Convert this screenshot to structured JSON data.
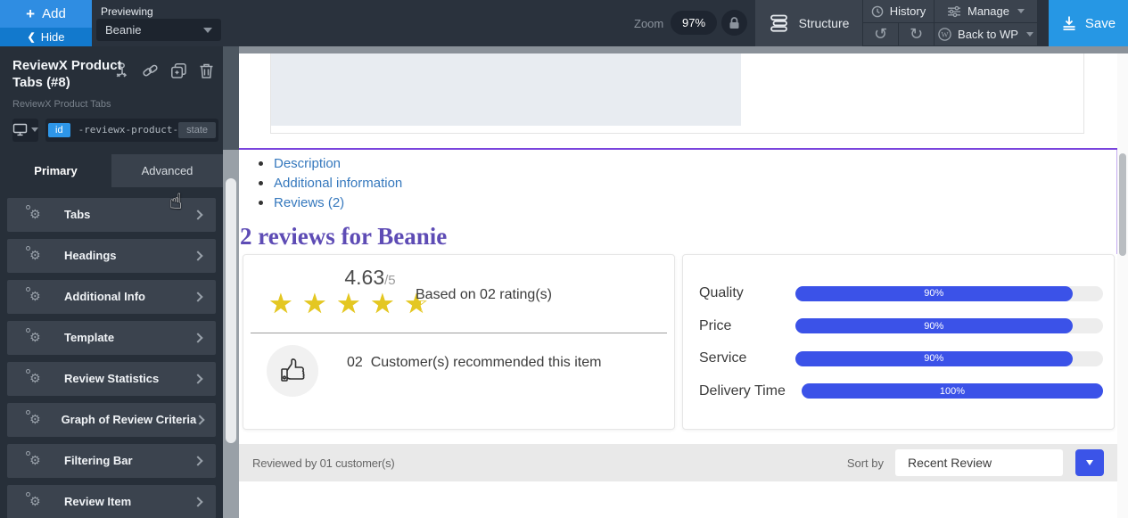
{
  "toolbar": {
    "add_label": "Add",
    "hide_label": "Hide",
    "previewing_label": "Previewing",
    "preview_value": "Beanie",
    "zoom_label": "Zoom",
    "zoom_value": "97%",
    "structure_label": "Structure",
    "history_label": "History",
    "manage_label": "Manage",
    "back_to_wp_label": "Back to WP",
    "save_label": "Save"
  },
  "sidebar": {
    "title": "ReviewX Product Tabs (#8)",
    "subtitle": "ReviewX Product Tabs",
    "id_badge": "id",
    "id_value": "-reviewx-product-",
    "state_label": "state",
    "tabs": [
      {
        "label": "Primary",
        "active": true
      },
      {
        "label": "Advanced",
        "active": false
      }
    ],
    "items": [
      "Tabs",
      "Headings",
      "Additional Info",
      "Template",
      "Review Statistics",
      "Graph of Review Criteria",
      "Filtering Bar",
      "Review Item"
    ]
  },
  "preview": {
    "tab_links": [
      "Description",
      "Additional information",
      "Reviews (2)"
    ],
    "heading": "2 reviews for Beanie",
    "rating": {
      "score": "4.63",
      "out_of": "/5",
      "stars_value": 4.6,
      "based_on": "Based on 02 rating(s)",
      "recommended_count": "02",
      "recommended_text": "Customer(s) recommended this item"
    },
    "criteria": {
      "type": "bar",
      "categories": [
        "Quality",
        "Price",
        "Service",
        "Delivery Time"
      ],
      "values": [
        90,
        90,
        90,
        100
      ],
      "labels": [
        "90%",
        "90%",
        "90%",
        "100%"
      ]
    },
    "filter_bar": {
      "reviewed": "Reviewed by 01 customer(s)",
      "sort_label": "Sort by",
      "sort_value": "Recent Review"
    }
  },
  "colors": {
    "accent_blue": "#2f8de2",
    "save_blue": "#2697e4",
    "bar_blue": "#3b52e8",
    "selection_purple": "#7a44dd",
    "link_blue": "#3578bd",
    "heading_purple": "#5e4cb5",
    "star_yellow": "#e4c722"
  }
}
